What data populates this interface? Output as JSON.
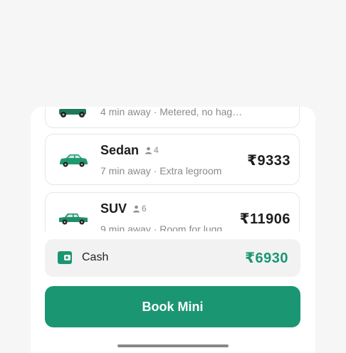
{
  "rides": [
    {
      "name": "",
      "seats": "",
      "meta": "4 min away · Metered, no hag…",
      "price": ""
    },
    {
      "name": "Sedan",
      "seats": "4",
      "meta": "7 min away · Extra legroom",
      "price": "₹9333"
    },
    {
      "name": "SUV",
      "seats": "6",
      "meta": "9 min away · Room for lugg",
      "price": "₹11906"
    }
  ],
  "payment": {
    "method": "Cash",
    "amount": "₹6930",
    "icon": "wallet-icon"
  },
  "book_button": {
    "label": "Book Mini"
  },
  "colors": {
    "accent": "#1a9672",
    "car": "#1f9a70"
  }
}
